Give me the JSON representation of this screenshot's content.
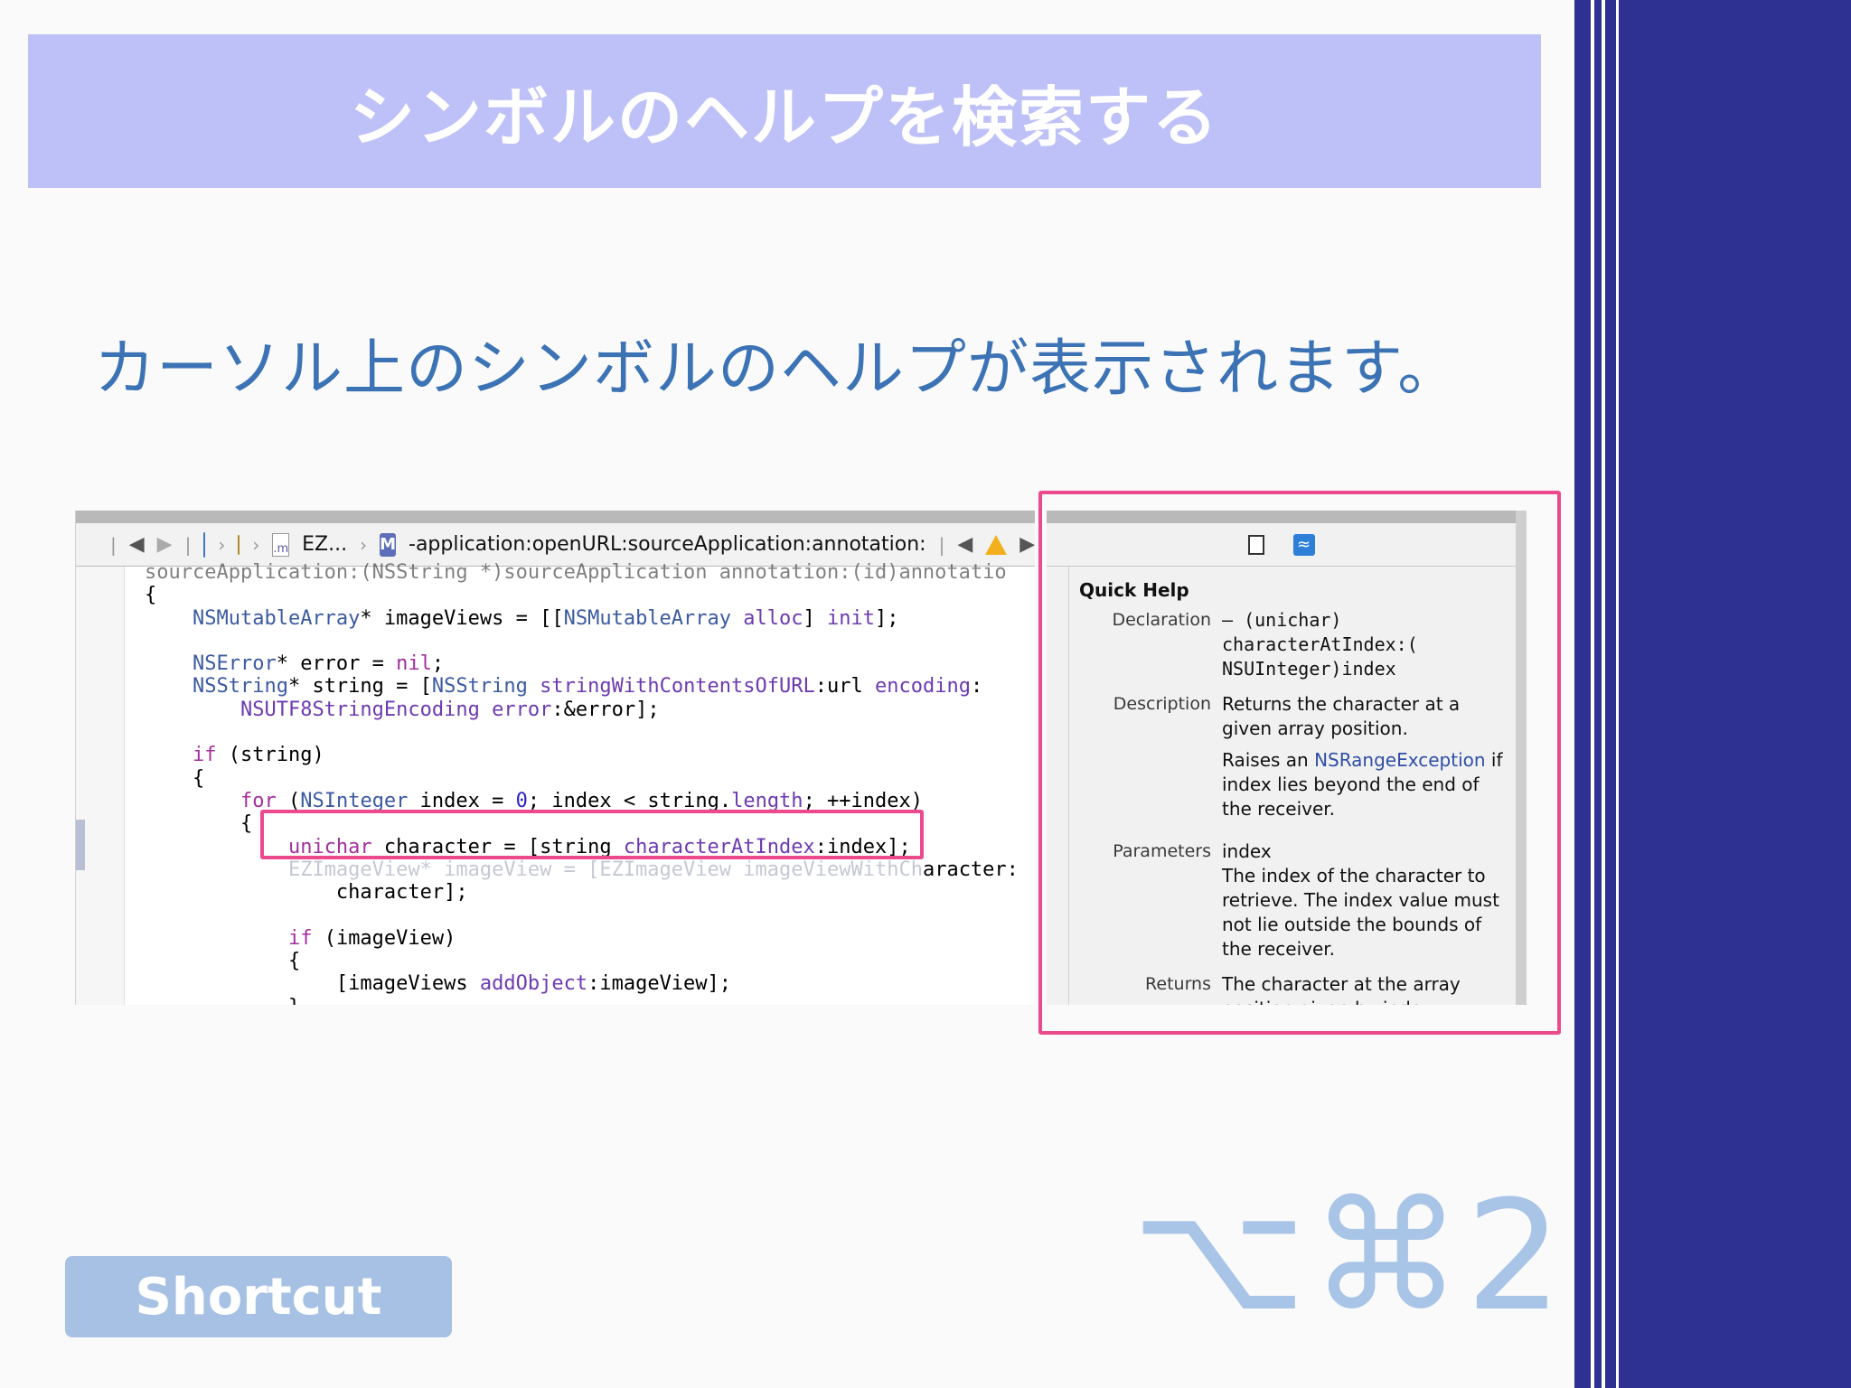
{
  "slide": {
    "title": "シンボルのヘルプを検索する",
    "subtitle": "カーソル上のシンボルのヘルプが表示されます。",
    "shortcut_label": "Shortcut",
    "shortcut_keys": "⌥⌘2",
    "colors": {
      "title_band": "#bec1f7",
      "subtitle": "#3c73b5",
      "right_stripe": "#2e3192",
      "highlight": "#ec4a8d",
      "shortcut_badge": "#a7c1e4"
    }
  },
  "jumpbar": {
    "grid_icon": "related-items-icon",
    "back_icon": "back-arrow-icon",
    "forward_icon": "forward-arrow-icon",
    "breadcrumb_file": "EZ...",
    "breadcrumb_method": "-application:openURL:sourceApplication:annotation:",
    "m_file_label": ".m",
    "method_badge": "M"
  },
  "code": {
    "line_cut": "sourceApplication:(NSString *)sourceApplication annotation:(id)annotatio",
    "lines": [
      "{",
      "    NSMutableArray* imageViews = [[NSMutableArray alloc] init];",
      "",
      "    NSError* error = nil;",
      "    NSString* string = [NSString stringWithContentsOfURL:url encoding:",
      "        NSUTF8StringEncoding error:&error];",
      "",
      "    if (string)",
      "    {",
      "        for (NSInteger index = 0; index < string.length; ++index)",
      "        {",
      "            unichar character = [string characterAtIndex:index];",
      "            EZImageView* imageView = [EZImageView imageViewWithCharacter:",
      "                character];",
      "",
      "            if (imageView)",
      "            {",
      "                [imageViews addObject:imageView];",
      "            }"
    ]
  },
  "quick_help": {
    "heading": "Quick Help",
    "declaration_label": "Declaration",
    "declaration": "– (unichar) characterAtIndex:( NSUInteger)index",
    "description_label": "Description",
    "description_1": "Returns the character at a given array position.",
    "description_2_prefix": "Raises an ",
    "description_2_link": "NSRangeException",
    "description_2_suffix": " if index lies beyond the end of the receiver.",
    "parameters_label": "Parameters",
    "param_name": "index",
    "param_desc": "The index of the character to retrieve. The index value must not lie outside the bounds of the receiver.",
    "returns_label": "Returns",
    "returns": "The character at the array position given by index."
  }
}
